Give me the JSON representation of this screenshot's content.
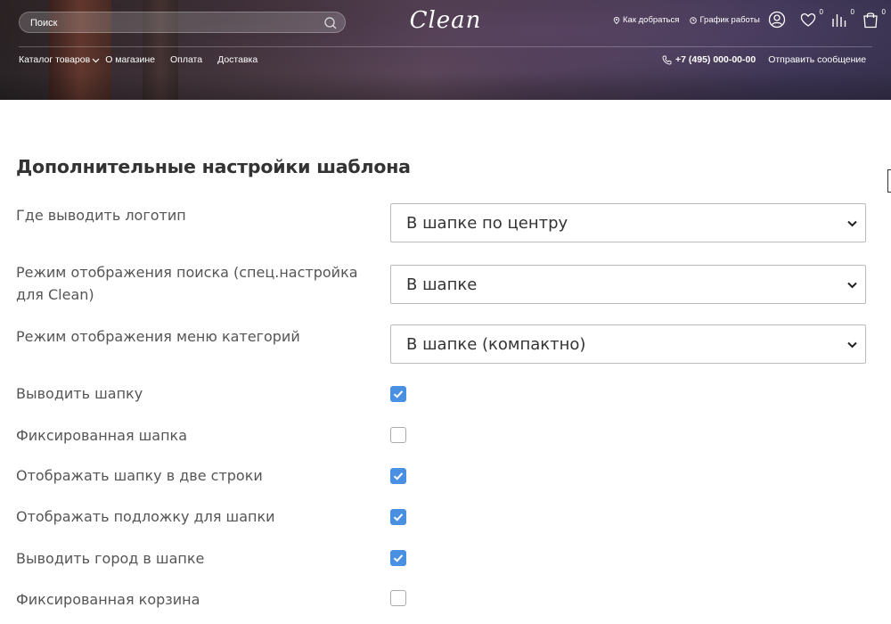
{
  "header": {
    "search": {
      "placeholder": "Поиск"
    },
    "logo": "Clean",
    "top_links": [
      {
        "label": "Как добраться",
        "icon": "location-pin-icon"
      },
      {
        "label": "График работы",
        "icon": "clock-icon"
      }
    ],
    "icons": {
      "account": {
        "icon": "user-icon"
      },
      "wishlist": {
        "icon": "heart-icon",
        "count": "0"
      },
      "compare": {
        "icon": "compare-bars-icon",
        "count": "0"
      },
      "cart": {
        "icon": "shopping-bag-icon",
        "count": "0"
      }
    },
    "menu": {
      "catalog": "Каталог товаров",
      "about": "О магазине",
      "payment": "Оплата",
      "delivery": "Доставка"
    },
    "phone": "+7 (495) 000-00-00",
    "send_message": "Отправить сообщение"
  },
  "settings": {
    "title": "Дополнительные настройки шаблона",
    "selects": [
      {
        "label": "Где выводить логотип",
        "value": "В шапке по центру"
      },
      {
        "label": "Режим отображения поиска (спец.настройка для Clean)",
        "value": "В шапке"
      },
      {
        "label": "Режим отображения меню категорий",
        "value": "В шапке (компактно)"
      }
    ],
    "checkboxes": [
      {
        "label": "Выводить шапку",
        "checked": true
      },
      {
        "label": "Фиксированная шапка",
        "checked": false
      },
      {
        "label": "Отображать шапку в две строки",
        "checked": true
      },
      {
        "label": "Отображать подложку для шапки",
        "checked": true
      },
      {
        "label": "Выводить город в шапке",
        "checked": true
      },
      {
        "label": "Фиксированная корзина",
        "checked": false
      }
    ]
  },
  "colors": {
    "accent": "#4a90e2",
    "text": "#555555",
    "title": "#333333"
  }
}
